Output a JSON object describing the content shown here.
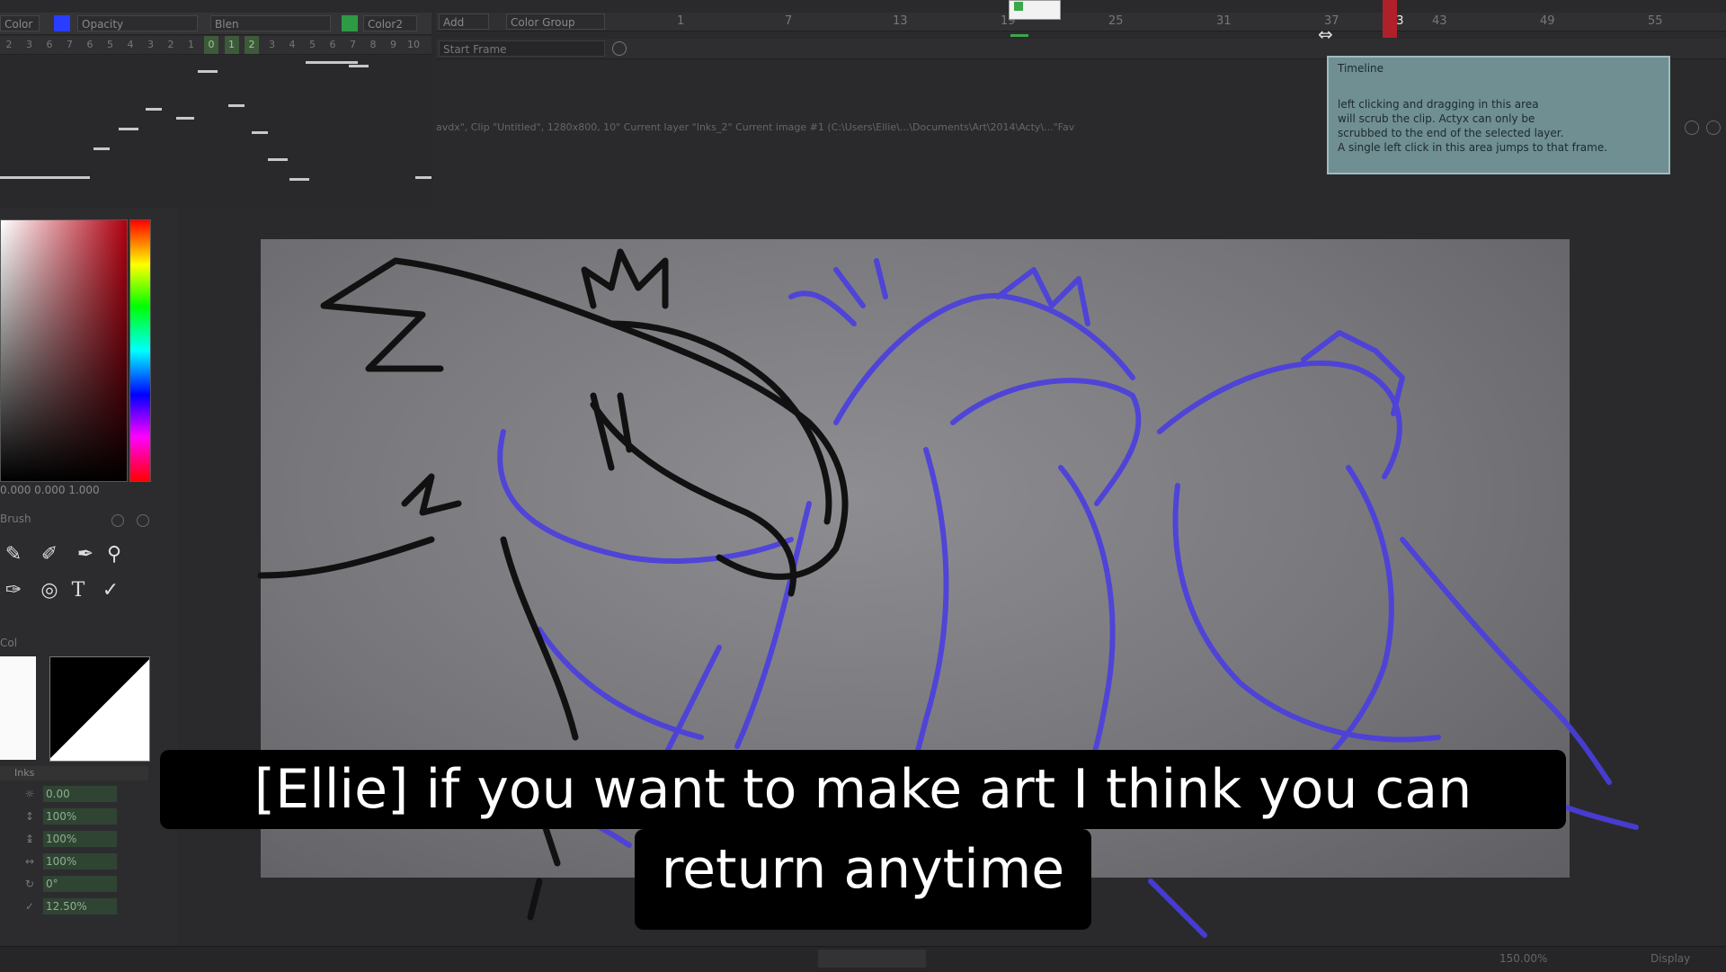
{
  "toolbar": {
    "color_label": "Color",
    "opacity_label": "Opacity",
    "blend_label": "Blen",
    "color2_label": "Color2",
    "add_label": "Add",
    "color_group_label": "Color Group",
    "accent_color": "#2a3cff",
    "green_color": "#2f9a45"
  },
  "frame_strip": {
    "numbers": [
      "2",
      "3",
      "6",
      "7",
      "6",
      "5",
      "4",
      "3",
      "2",
      "1",
      "0",
      "1",
      "2",
      "3",
      "4",
      "5",
      "6",
      "7",
      "8",
      "9",
      "10"
    ]
  },
  "timeline": {
    "ticks": [
      "1",
      "7",
      "13",
      "19",
      "25",
      "31",
      "37",
      "43",
      "49",
      "55"
    ],
    "start_frame_label": "Start Frame",
    "current_frame": "43",
    "layer_path": "avdx\", Clip \"Untitled\", 1280x800, 10\" Current layer \"Inks_2\" Current image #1 (C:\\Users\\Ellie\\...\\Documents\\Art\\2014\\Acty\\...\"Fav"
  },
  "tooltip": {
    "title": "Timeline",
    "line1": "left clicking and dragging in this area",
    "line2": "will scrub the clip. Actyx can only be",
    "line3": "scrubbed to the end of the selected layer.",
    "line4": "A single left click in this area jumps to that frame."
  },
  "left_panel": {
    "hsv_readout": "0.000 0.000 1.000",
    "brush_label": "Brush",
    "color_section_label": "Col",
    "layer_label": "Inks",
    "properties": [
      {
        "icon": "opacity-icon",
        "value": "0.00"
      },
      {
        "icon": "scale-icon",
        "value": "100%"
      },
      {
        "icon": "scale-y-icon",
        "value": "100%"
      },
      {
        "icon": "scale-x-icon",
        "value": "100%"
      },
      {
        "icon": "rotate-icon",
        "value": "0°"
      },
      {
        "icon": "check-icon",
        "value": "12.50%"
      }
    ],
    "tools": [
      "pencil-icon",
      "eraser-icon",
      "pen-icon",
      "brush-icon",
      "ink-pen-icon",
      "fill-icon",
      "text-icon",
      "eyedropper-icon"
    ]
  },
  "status": {
    "zoom": "150.00%",
    "display_label": "Display"
  },
  "subtitle": {
    "line1": "[Ellie] if you want to make art I think you can",
    "line2": "return anytime"
  }
}
